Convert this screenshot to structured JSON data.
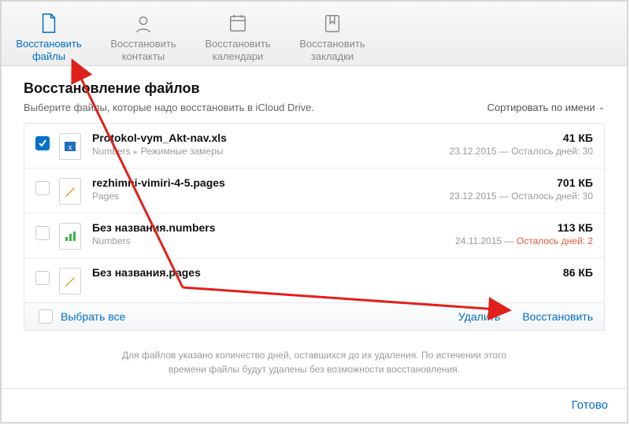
{
  "toolbar": {
    "tabs": [
      {
        "line1": "Восстановить",
        "line2": "файлы"
      },
      {
        "line1": "Восстановить",
        "line2": "контакты"
      },
      {
        "line1": "Восстановить",
        "line2": "календари"
      },
      {
        "line1": "Восстановить",
        "line2": "закладки"
      }
    ]
  },
  "main": {
    "title": "Восстановление файлов",
    "subtitle": "Выберите файлы, которые надо восстановить в iCloud Drive.",
    "sort_label": "Сортировать по имени"
  },
  "files": [
    {
      "checked": true,
      "name": "Protokol-vym_Akt-nav.xls",
      "app": "Numbers",
      "folder": "Режимные замеры",
      "size": "41 КБ",
      "date": "23.12.2015",
      "days_label": "Осталось дней: 30",
      "warn": false
    },
    {
      "checked": false,
      "name": "rezhimni-vimiri-4-5.pages",
      "app": "Pages",
      "folder": "",
      "size": "701 КБ",
      "date": "23.12.2015",
      "days_label": "Осталось дней: 30",
      "warn": false
    },
    {
      "checked": false,
      "name": "Без названия.numbers",
      "app": "Numbers",
      "folder": "",
      "size": "113 КБ",
      "date": "24.11.2015",
      "days_label": "Осталось дней: 2",
      "warn": true
    },
    {
      "checked": false,
      "name": "Без названия.pages",
      "app": "",
      "folder": "",
      "size": "86 КБ",
      "date": "",
      "days_label": "",
      "warn": false
    }
  ],
  "actions": {
    "select_all": "Выбрать все",
    "delete": "Удалить",
    "restore": "Восстановить"
  },
  "footnote": "Для файлов указано количество дней, оставшихся до их удаления. По истечении этого времени файлы будут удалены без возможности восстановления.",
  "footer": {
    "done": "Готово"
  }
}
